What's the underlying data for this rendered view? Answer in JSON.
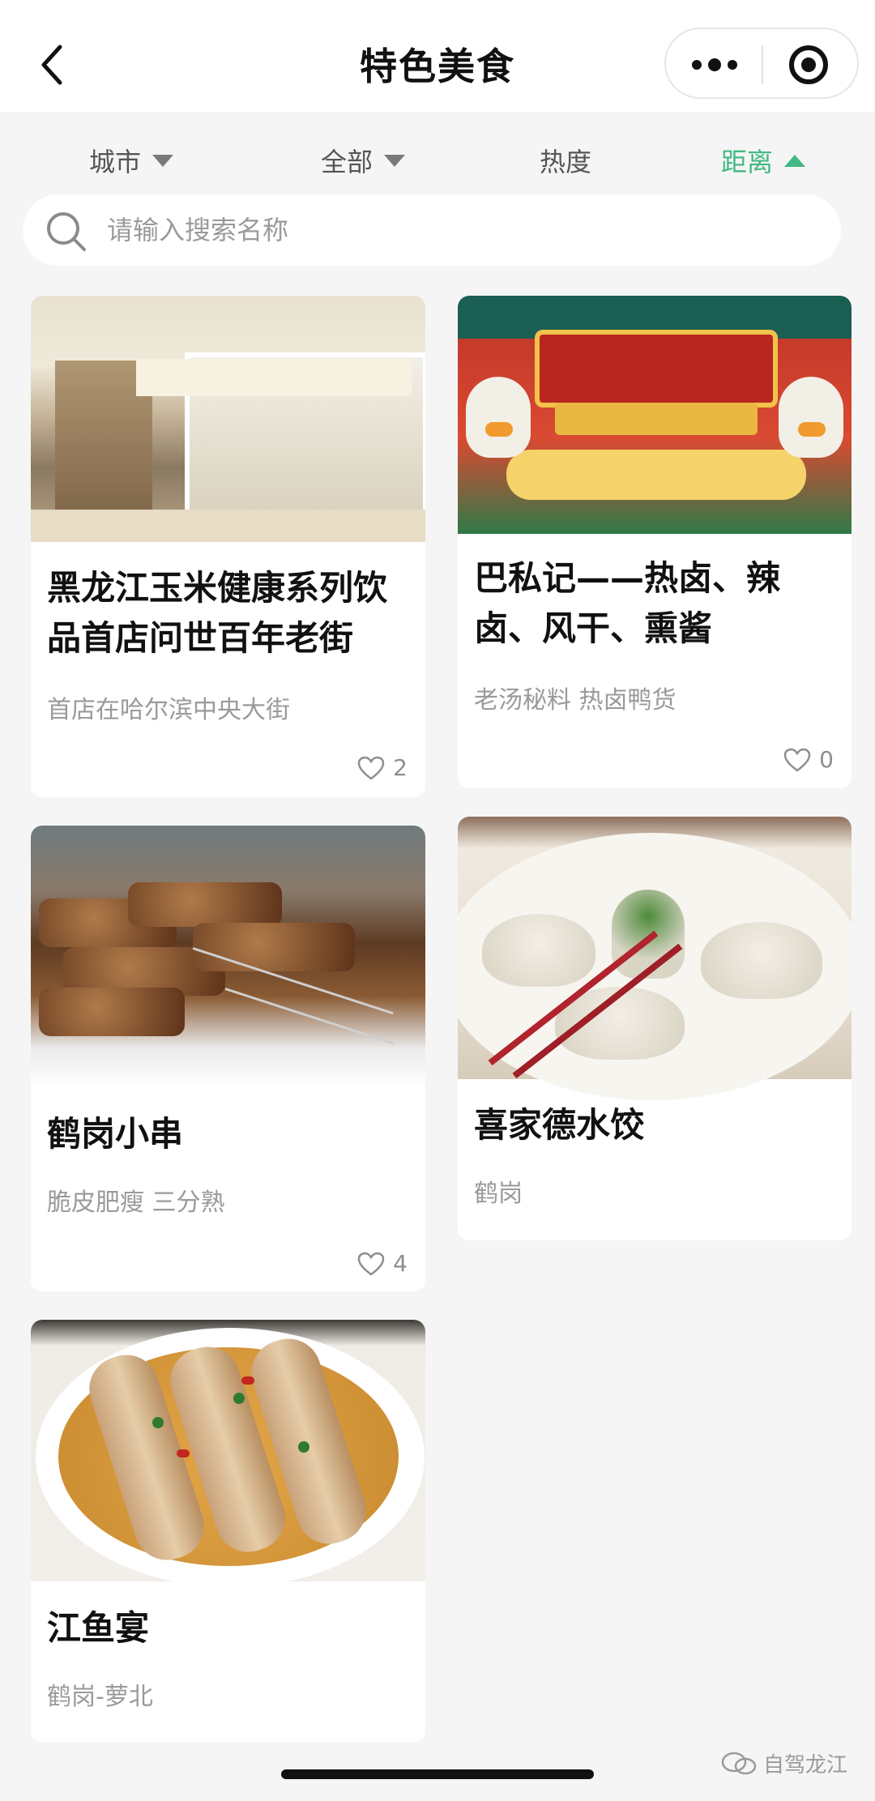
{
  "header": {
    "title": "特色美食"
  },
  "filters": [
    {
      "label": "城市",
      "active": false
    },
    {
      "label": "全部",
      "active": false
    },
    {
      "label": "热度",
      "active": false
    },
    {
      "label": "距离",
      "active": true
    }
  ],
  "search": {
    "placeholder": "请输入搜索名称",
    "value": ""
  },
  "cards": [
    {
      "title": "黑龙江玉米健康系列饮品首店问世百年老街",
      "subtitle": "首店在哈尔滨中央大街",
      "likes": "2"
    },
    {
      "title": "巴私记——热卤、辣卤、风干、熏酱",
      "subtitle": "老汤秘料 热卤鸭货",
      "likes": "0"
    },
    {
      "title": "鹤岗小串",
      "subtitle": "脆皮肥瘦 三分熟",
      "likes": "4"
    },
    {
      "title": "喜家德水饺",
      "subtitle": "鹤岗"
    },
    {
      "title": "江鱼宴",
      "subtitle": "鹤岗-萝北"
    }
  ],
  "watermark": "自驾龙江",
  "colors": {
    "accent": "#43b883",
    "background": "#f5f5f5"
  }
}
